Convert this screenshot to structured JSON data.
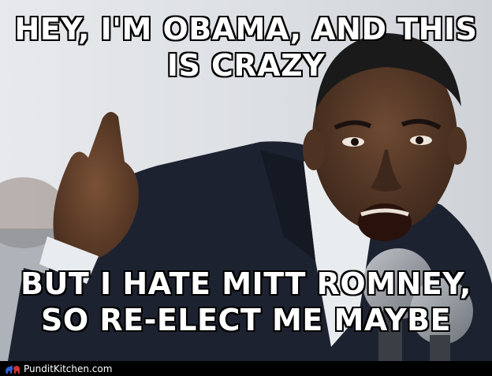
{
  "meme": {
    "top_caption": [
      "HEY, I'M OBAMA, AND THIS",
      "IS CRAZY"
    ],
    "bottom_caption": [
      "BUT I HATE MITT ROMNEY,",
      "SO RE-ELECT ME MAYBE"
    ]
  },
  "watermark": {
    "text": "PunditKitchen.com",
    "logo_icon": "donkey-elephant-logo-icon"
  },
  "colors": {
    "caption_fill": "#ffffff",
    "caption_outline": "#000000",
    "watermark_bar": "#000000",
    "suit": "#1d2230",
    "skin": "#5a3a26"
  }
}
